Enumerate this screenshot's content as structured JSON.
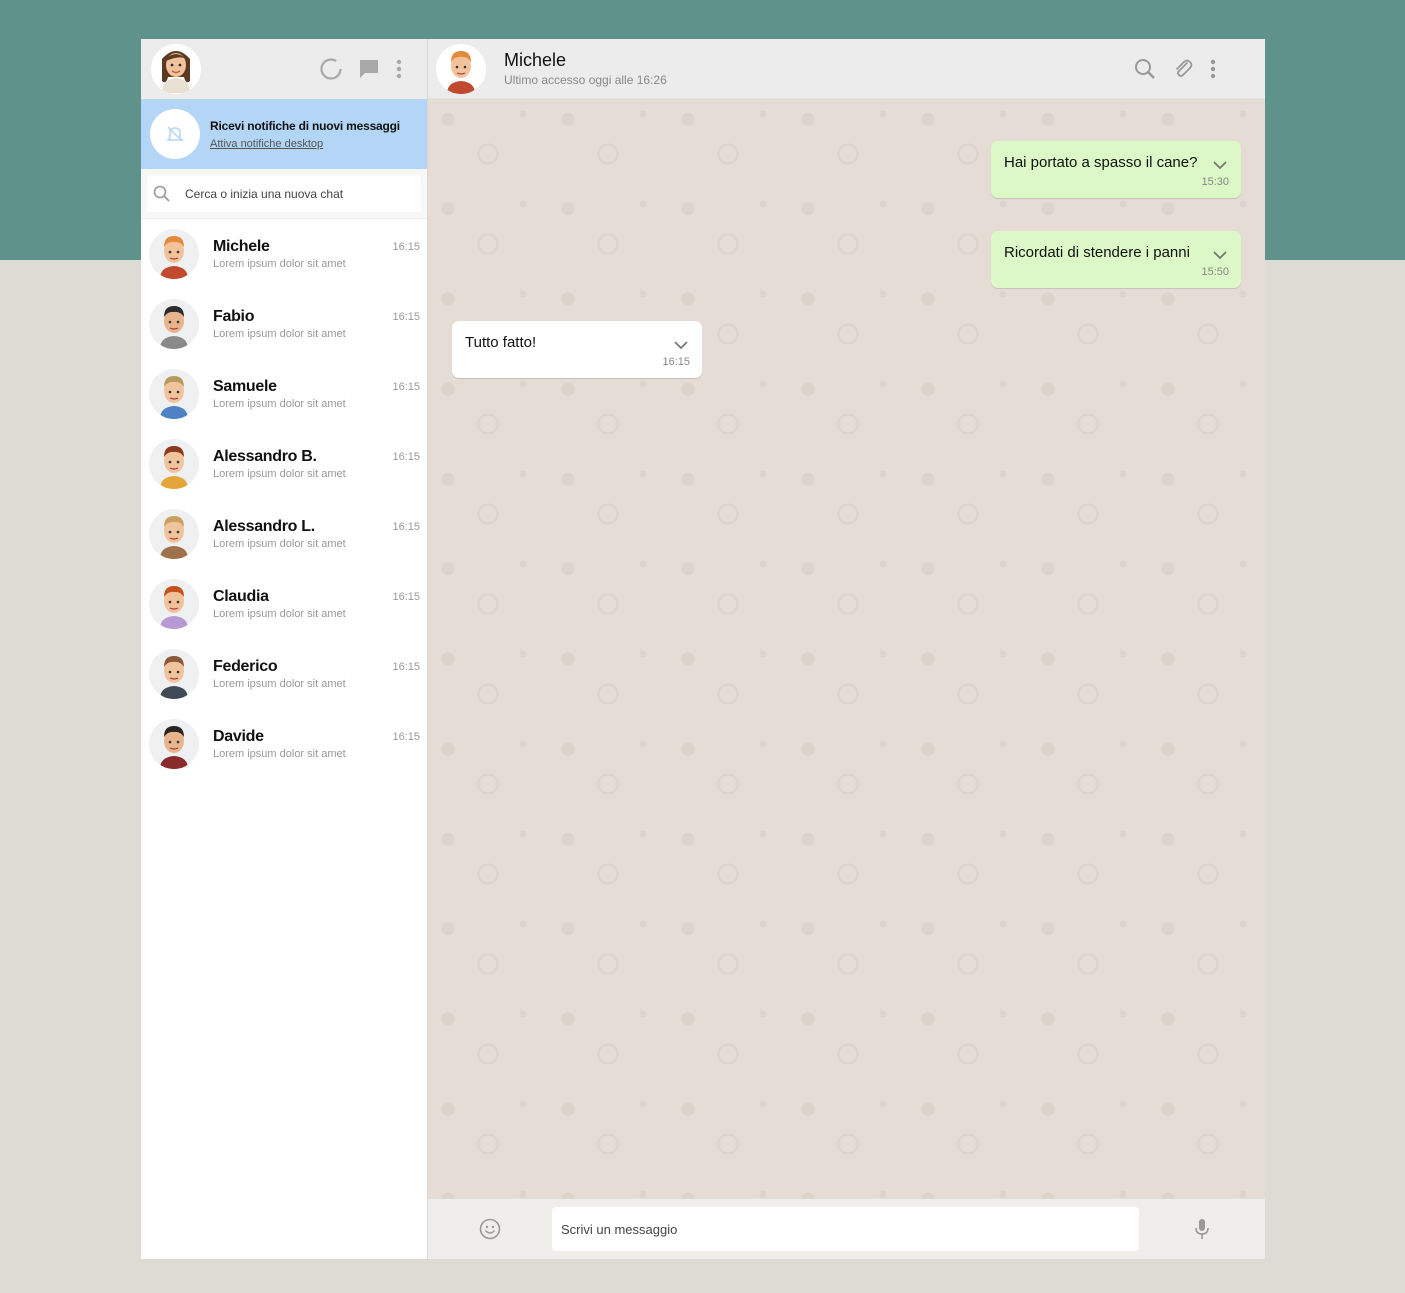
{
  "colors": {
    "top_band": "#5e928a",
    "outgoing_bubble": "#dcf8c6",
    "notif_banner": "#b3d6f7"
  },
  "sidebar": {
    "header_icons": [
      "status-icon",
      "new-chat-icon",
      "menu-icon"
    ],
    "notification": {
      "title": "Ricevi notifiche di nuovi messaggi",
      "link": "Attiva notifiche desktop"
    },
    "search": {
      "placeholder": "Cerca o inizia una nuova chat"
    },
    "contacts": [
      {
        "name": "Michele",
        "preview": "Lorem ipsum dolor sit amet",
        "time": "16:15",
        "hair": "#e38b3c",
        "shirt": "#c0492e",
        "skin": "#f2c29a"
      },
      {
        "name": "Fabio",
        "preview": "Lorem ipsum dolor sit amet",
        "time": "16:15",
        "hair": "#2d2d2d",
        "shirt": "#8a8a8a",
        "skin": "#e7b58c"
      },
      {
        "name": "Samuele",
        "preview": "Lorem ipsum dolor sit amet",
        "time": "16:15",
        "hair": "#b89a5e",
        "shirt": "#4f82c4",
        "skin": "#f0c49c"
      },
      {
        "name": "Alessandro B.",
        "preview": "Lorem ipsum dolor sit amet",
        "time": "16:15",
        "hair": "#8a3a1e",
        "shirt": "#e4a63a",
        "skin": "#f0c49c"
      },
      {
        "name": "Alessandro L.",
        "preview": "Lorem ipsum dolor sit amet",
        "time": "16:15",
        "hair": "#c9a25e",
        "shirt": "#a0704a",
        "skin": "#f0c49c"
      },
      {
        "name": "Claudia",
        "preview": "Lorem ipsum dolor sit amet",
        "time": "16:15",
        "hair": "#c2511e",
        "shirt": "#b79ad4",
        "skin": "#f2c29a"
      },
      {
        "name": "Federico",
        "preview": "Lorem ipsum dolor sit amet",
        "time": "16:15",
        "hair": "#8a5a3a",
        "shirt": "#404a55",
        "skin": "#f0c49c"
      },
      {
        "name": "Davide",
        "preview": "Lorem ipsum dolor sit amet",
        "time": "16:15",
        "hair": "#2a2420",
        "shirt": "#8a2a2a",
        "skin": "#e7b58c"
      }
    ]
  },
  "chat": {
    "header": {
      "name": "Michele",
      "status": "Ultimo accesso oggi alle 16:26"
    },
    "header_icons": [
      "search-icon",
      "attach-icon",
      "menu-icon"
    ],
    "messages": [
      {
        "direction": "out",
        "text": "Hai portato a spasso il cane?",
        "time": "15:30"
      },
      {
        "direction": "out",
        "text": "Ricordati di stendere i panni",
        "time": "15:50"
      },
      {
        "direction": "in",
        "text": "Tutto fatto!",
        "time": "16:15"
      }
    ],
    "composer": {
      "placeholder": "Scrivi un messaggio"
    }
  }
}
